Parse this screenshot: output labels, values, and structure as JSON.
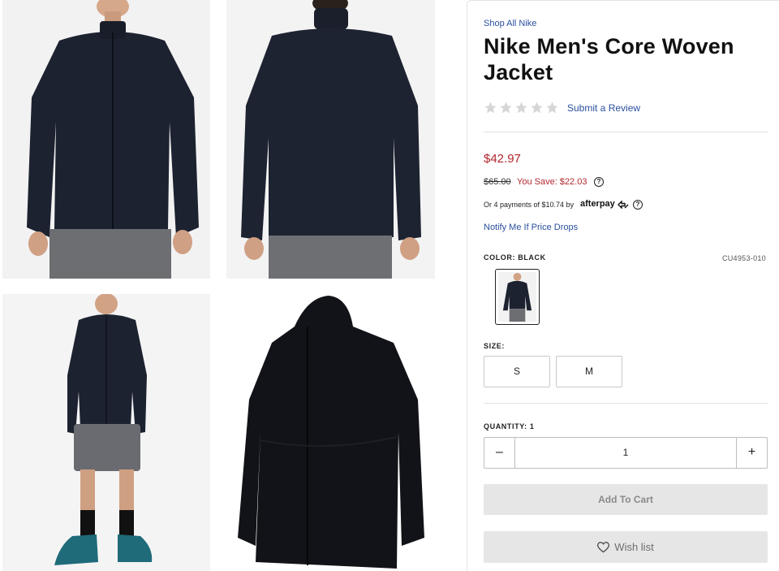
{
  "gallery": {
    "images": [
      {
        "name": "front-view"
      },
      {
        "name": "back-view"
      },
      {
        "name": "full-body-view"
      },
      {
        "name": "product-flat-view"
      }
    ]
  },
  "product": {
    "brand_link": "Shop All Nike",
    "title": "Nike Men's Core Woven Jacket",
    "rating": 0,
    "review_link": "Submit a Review",
    "price": "$42.97",
    "original_price": "$65.00",
    "savings": "You Save: $22.03",
    "installments": "Or 4 payments of $10.74 by",
    "installment_provider": "afterpay",
    "notify_link": "Notify Me If Price Drops",
    "color_label": "COLOR:",
    "color_value": "BLACK",
    "sku": "CU4953-010",
    "size_label": "SIZE:",
    "sizes": [
      "S",
      "M"
    ],
    "quantity_label": "QUANTITY:",
    "quantity_label_value": "1",
    "quantity": "1",
    "qty_minus": "–",
    "qty_plus": "+",
    "add_to_cart": "Add To Cart",
    "wish_list": "Wish list",
    "help_glyph": "?"
  },
  "colors": {
    "link": "#2a4f9e",
    "sale": "#b3262d",
    "button_bg": "#e6e6e6",
    "star_empty": "#d6d6d6"
  }
}
